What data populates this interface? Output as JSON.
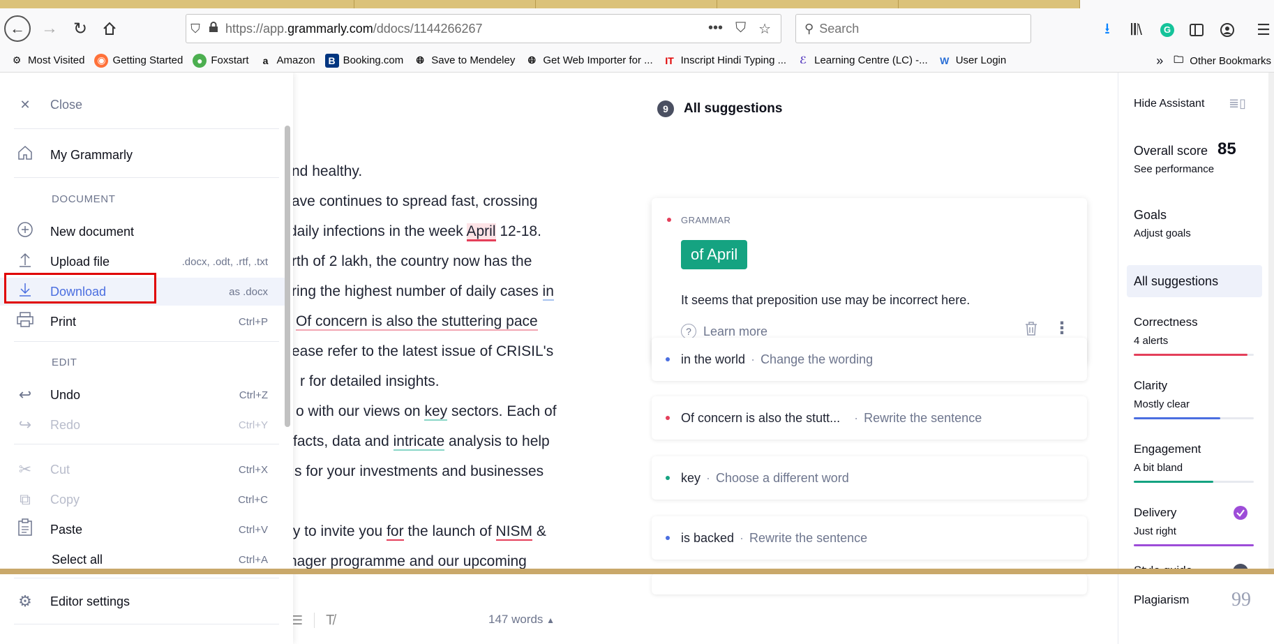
{
  "browser": {
    "url_host_prefix": "https://app.",
    "url_host": "grammarly.com",
    "url_path": "/ddocs/1144266267",
    "search_placeholder": "Search",
    "bookmarks": [
      {
        "label": "Most Visited",
        "icon": "gear-icon"
      },
      {
        "label": "Getting Started",
        "icon": "firefox-icon"
      },
      {
        "label": "Foxstart",
        "icon": "globe-icon"
      },
      {
        "label": "Amazon",
        "icon": "amazon-icon"
      },
      {
        "label": "Booking.com",
        "icon": "booking-icon"
      },
      {
        "label": "Save to Mendeley",
        "icon": "globe-icon"
      },
      {
        "label": "Get Web Importer for ...",
        "icon": "globe-icon"
      },
      {
        "label": "Inscript Hindi Typing ...",
        "icon": "it-icon"
      },
      {
        "label": "Learning Centre (LC) -...",
        "icon": "lc-icon"
      },
      {
        "label": "User Login",
        "icon": "w-icon"
      }
    ],
    "other_bookmarks": "Other Bookmarks",
    "colors": {
      "grammarly_green": "#15a381",
      "tab_strip": "#dbc27a"
    }
  },
  "menu": {
    "close": "Close",
    "my_grammarly": "My Grammarly",
    "section_document": "DOCUMENT",
    "new_document": "New document",
    "upload_file": "Upload file",
    "upload_formats": ".docx, .odt, .rtf, .txt",
    "download": "Download",
    "download_format": "as .docx",
    "print": "Print",
    "print_sc": "Ctrl+P",
    "section_edit": "EDIT",
    "undo": "Undo",
    "undo_sc": "Ctrl+Z",
    "redo": "Redo",
    "redo_sc": "Ctrl+Y",
    "cut": "Cut",
    "cut_sc": "Ctrl+X",
    "copy": "Copy",
    "copy_sc": "Ctrl+C",
    "paste": "Paste",
    "paste_sc": "Ctrl+V",
    "select_all": "Select all",
    "select_all_sc": "Ctrl+A",
    "editor_settings": "Editor settings"
  },
  "editor": {
    "lines": [
      "nd healthy.",
      "ave continues to spread fast, crossing",
      "daily infections in the week",
      "April",
      "12-18.",
      "rth of 2 lakh, the country now has the",
      "ring the highest number of daily cases",
      "in",
      "Of concern is also the stuttering pace",
      "ease refer to the latest issue of CRISIL's",
      "r for detailed insights.",
      "o with our views on",
      "key",
      "sectors. Each of",
      "facts, data and",
      "intricate",
      "analysis to help",
      "s for your investments and businesses",
      "ty to invite you",
      "for",
      "the launch of",
      "NISM",
      "&",
      "nager programme and our upcoming"
    ],
    "word_count": "147 words"
  },
  "suggestions": {
    "count": "9",
    "title": "All suggestions",
    "main": {
      "category": "GRAMMAR",
      "replacement": "of April",
      "explanation": "It seems that preposition use may be incorrect here.",
      "learn_more": "Learn more"
    },
    "rows": [
      {
        "term": "in the world",
        "action": "Change the wording",
        "color": "#4a6ee0"
      },
      {
        "term": "Of concern is also the stutt...",
        "action": "Rewrite the sentence",
        "color": "#e43f5a"
      },
      {
        "term": "key",
        "action": "Choose a different word",
        "color": "#15a381"
      },
      {
        "term": "is backed",
        "action": "Rewrite the sentence",
        "color": "#4a6ee0"
      }
    ]
  },
  "assistant": {
    "hide": "Hide Assistant",
    "overall_label": "Overall score",
    "overall_score": "85",
    "see_performance": "See performance",
    "goals": "Goals",
    "adjust_goals": "Adjust goals",
    "all_suggestions": "All suggestions",
    "correctness": "Correctness",
    "correctness_sub": "4 alerts",
    "correctness_color": "#e43f5a",
    "correctness_level": 0.95,
    "clarity": "Clarity",
    "clarity_sub": "Mostly clear",
    "clarity_color": "#4a6ee0",
    "clarity_level": 0.72,
    "engagement": "Engagement",
    "engagement_sub": "A bit bland",
    "engagement_color": "#15a381",
    "engagement_level": 0.66,
    "delivery": "Delivery",
    "delivery_sub": "Just right",
    "delivery_color": "#9d4cd8",
    "delivery_level": 1.0,
    "style_guide": "Style guide",
    "plagiarism": "Plagiarism"
  }
}
